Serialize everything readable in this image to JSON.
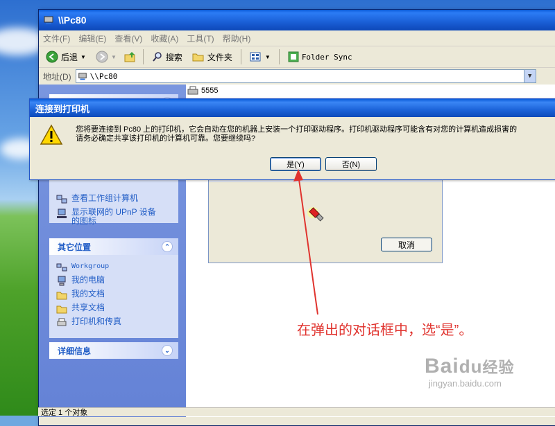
{
  "window": {
    "title": "\\\\Pc80"
  },
  "menubar": [
    "文件(F)",
    "编辑(E)",
    "查看(V)",
    "收藏(A)",
    "工具(T)",
    "帮助(H)"
  ],
  "toolbar": {
    "back_label": "后退",
    "search_label": "搜索",
    "folders_label": "文件夹",
    "sync_label": "Folder Sync"
  },
  "addressbar": {
    "label": "地址(D)",
    "value": "\\\\Pc80"
  },
  "left_panels": {
    "network_tasks": {
      "items": [
        {
          "label": "查看工作组计算机",
          "icon": "network-computers-icon"
        },
        {
          "label": "显示联网的 UPnP 设备的图标",
          "icon": "upnp-icon"
        }
      ]
    },
    "other_places": {
      "title": "其它位置",
      "items": [
        {
          "label": "Workgroup",
          "icon": "workgroup-icon"
        },
        {
          "label": "我的电脑",
          "icon": "my-computer-icon"
        },
        {
          "label": "我的文档",
          "icon": "my-documents-icon"
        },
        {
          "label": "共享文档",
          "icon": "shared-documents-icon"
        },
        {
          "label": "打印机和传真",
          "icon": "printers-icon"
        }
      ]
    },
    "details": {
      "title": "详细信息"
    }
  },
  "files": [
    {
      "name": "5555",
      "icon": "printer-icon"
    }
  ],
  "connecting_dialog": {
    "cancel_label": "取消"
  },
  "modal": {
    "title": "连接到打印机",
    "message_line1": "您将要连接到 Pc80 上的打印机，它会自动在您的机器上安装一个打印驱动程序。打印机驱动程序可能含有对您的计算机造成损害的",
    "message_line2": "请务必确定共享该打印机的计算机可靠。您要继续吗?",
    "yes_label": "是(Y)",
    "no_label": "否(N)"
  },
  "statusbar": {
    "text": "选定 1 个对象"
  },
  "annotation": {
    "text": "在弹出的对话框中，选“是”。",
    "color": "#e0332e"
  },
  "watermark": {
    "brand": "Bai",
    "brand_suffix": "经验",
    "url": "jingyan.baidu.com"
  }
}
